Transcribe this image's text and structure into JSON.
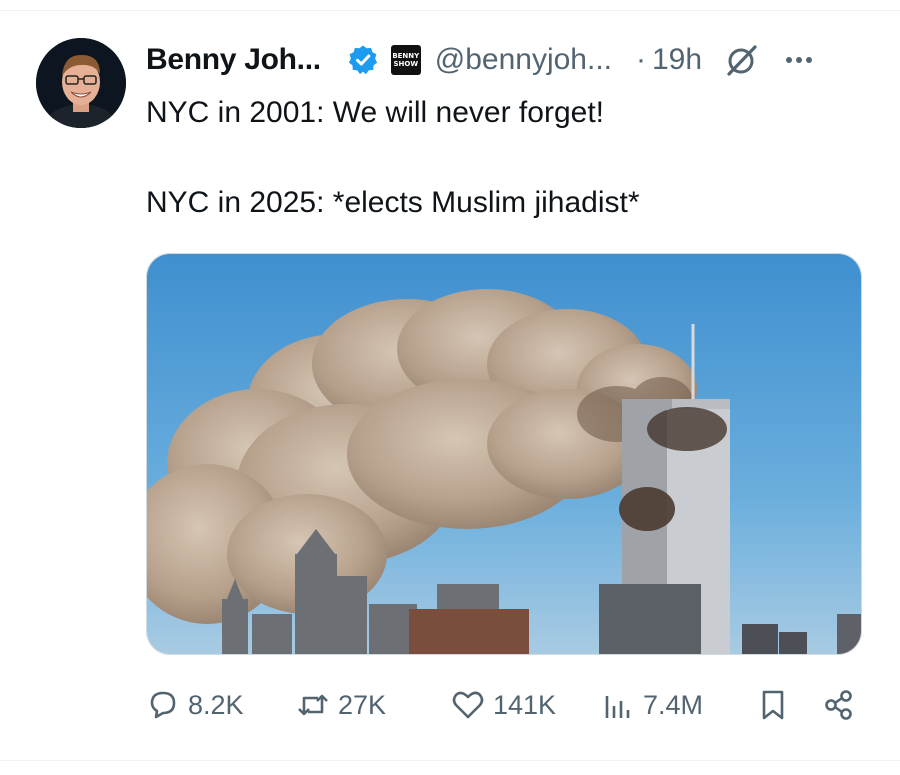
{
  "author": {
    "display_name": "Benny Joh...",
    "handle": "@bennyjoh...",
    "affiliate_badge": [
      "BENNY",
      "SHOW"
    ],
    "timestamp": "19h"
  },
  "tweet": {
    "lines": [
      "NYC in 2001: We will never forget!",
      "NYC in 2025: *elects Muslim jihadist*"
    ]
  },
  "metrics": {
    "replies": "8.2K",
    "reposts": "27K",
    "likes": "141K",
    "views": "7.4M"
  },
  "icons": {
    "verified": "verified-badge-icon",
    "grok": "grok-icon",
    "more": "more-icon",
    "reply": "reply-icon",
    "repost": "repost-icon",
    "like": "heart-icon",
    "views": "views-icon",
    "bookmark": "bookmark-icon",
    "share": "share-icon"
  },
  "colors": {
    "verified_blue": "#1d9bf0",
    "secondary_text": "#536471",
    "primary_text": "#0f1419"
  }
}
